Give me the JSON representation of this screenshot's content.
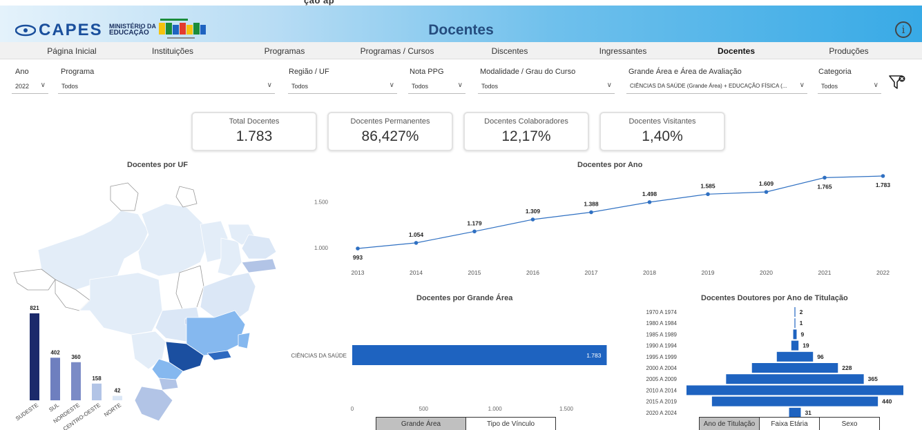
{
  "header": {
    "cut_title": "ção    ap",
    "logo_text": "CAPES",
    "ministry_line1": "MINISTÉRIO DA",
    "ministry_line2": "EDUCAÇÃO",
    "title": "Docentes",
    "info_glyph": "i"
  },
  "nav": {
    "items": [
      "Página Inicial",
      "Instituições",
      "Programas",
      "Programas / Cursos",
      "Discentes",
      "Ingressantes",
      "Docentes",
      "Produções"
    ],
    "active": "Docentes"
  },
  "filters": {
    "ano": {
      "label": "Ano",
      "value": "2022"
    },
    "programa": {
      "label": "Programa",
      "value": "Todos"
    },
    "regiao": {
      "label": "Região / UF",
      "value": "Todos"
    },
    "nota": {
      "label": "Nota PPG",
      "value": "Todos"
    },
    "modalidade": {
      "label": "Modalidade / Grau do Curso",
      "value": "Todos"
    },
    "area": {
      "label": "Grande Área e Área de Avaliação",
      "value": "CIÊNCIAS DA SAÚDE (Grande Área) + EDUCAÇÃO FÍSICA (..."
    },
    "categoria": {
      "label": "Categoria",
      "value": "Todos"
    }
  },
  "cards": [
    {
      "label": "Total Docentes",
      "value": "1.783"
    },
    {
      "label": "Docentes Permanentes",
      "value": "86,427%"
    },
    {
      "label": "Docentes Colaboradores",
      "value": "12,17%"
    },
    {
      "label": "Docentes Visitantes",
      "value": "1,40%"
    }
  ],
  "map": {
    "title": "Docentes por UF"
  },
  "chart_data": [
    {
      "type": "bar",
      "orientation": "vertical",
      "categories": [
        "SUDESTE",
        "SUL",
        "NORDESTE",
        "CENTRO-OESTE",
        "NORTE"
      ],
      "values": [
        821,
        402,
        360,
        158,
        42
      ],
      "colors": [
        "#1b2a6b",
        "#6e7fbf",
        "#7b8bc6",
        "#b2c4e6",
        "#dbe7f6"
      ]
    },
    {
      "type": "line",
      "title": "Docentes por Ano",
      "x": [
        "2013",
        "2014",
        "2015",
        "2016",
        "2017",
        "2018",
        "2019",
        "2020",
        "2021",
        "2022"
      ],
      "values": [
        993,
        1054,
        1179,
        1309,
        1388,
        1498,
        1585,
        1609,
        1765,
        1783
      ],
      "labels": [
        "993",
        "1.054",
        "1.179",
        "1.309",
        "1.388",
        "1.498",
        "1.585",
        "1.609",
        "1.765",
        "1.783"
      ],
      "yticks": [
        1000,
        1500
      ],
      "ytick_labels": [
        "1.000",
        "1.500"
      ],
      "color": "#2f70c2"
    },
    {
      "type": "bar",
      "orientation": "horizontal",
      "title": "Docentes por Grande Área",
      "categories": [
        "CIÊNCIAS DA SAÚDE"
      ],
      "values": [
        1783
      ],
      "labels": [
        "1.783"
      ],
      "xticks": [
        0,
        500,
        1000,
        1500
      ],
      "xtick_labels": [
        "0",
        "500",
        "1.000",
        "1.500"
      ],
      "color": "#1e63c0"
    },
    {
      "type": "bar",
      "orientation": "horizontal-centered",
      "title": "Docentes Doutores por Ano de Titulação",
      "categories": [
        "1970 A 1974",
        "1980 A 1984",
        "1985 A 1989",
        "1990 A 1994",
        "1995 A 1999",
        "2000 A 2004",
        "2005 A 2009",
        "2010 A 2014",
        "2015 A 2019",
        "2020 A 2024"
      ],
      "values": [
        2,
        1,
        9,
        19,
        96,
        228,
        365,
        575,
        440,
        31
      ],
      "labels": [
        "2",
        "1",
        "9",
        "19",
        "96",
        "228",
        "365",
        "",
        "440",
        "31"
      ],
      "color": "#1e63c0"
    }
  ],
  "tabs_area": [
    "Grande Área",
    "Tipo de Vínculo"
  ],
  "tabs_titulacao": [
    "Ano de Titulação",
    "Faixa Etária",
    "Sexo"
  ],
  "colors": {
    "accent": "#1e63c0",
    "header_start": "#e4f2fb",
    "header_end": "#38aae6"
  }
}
